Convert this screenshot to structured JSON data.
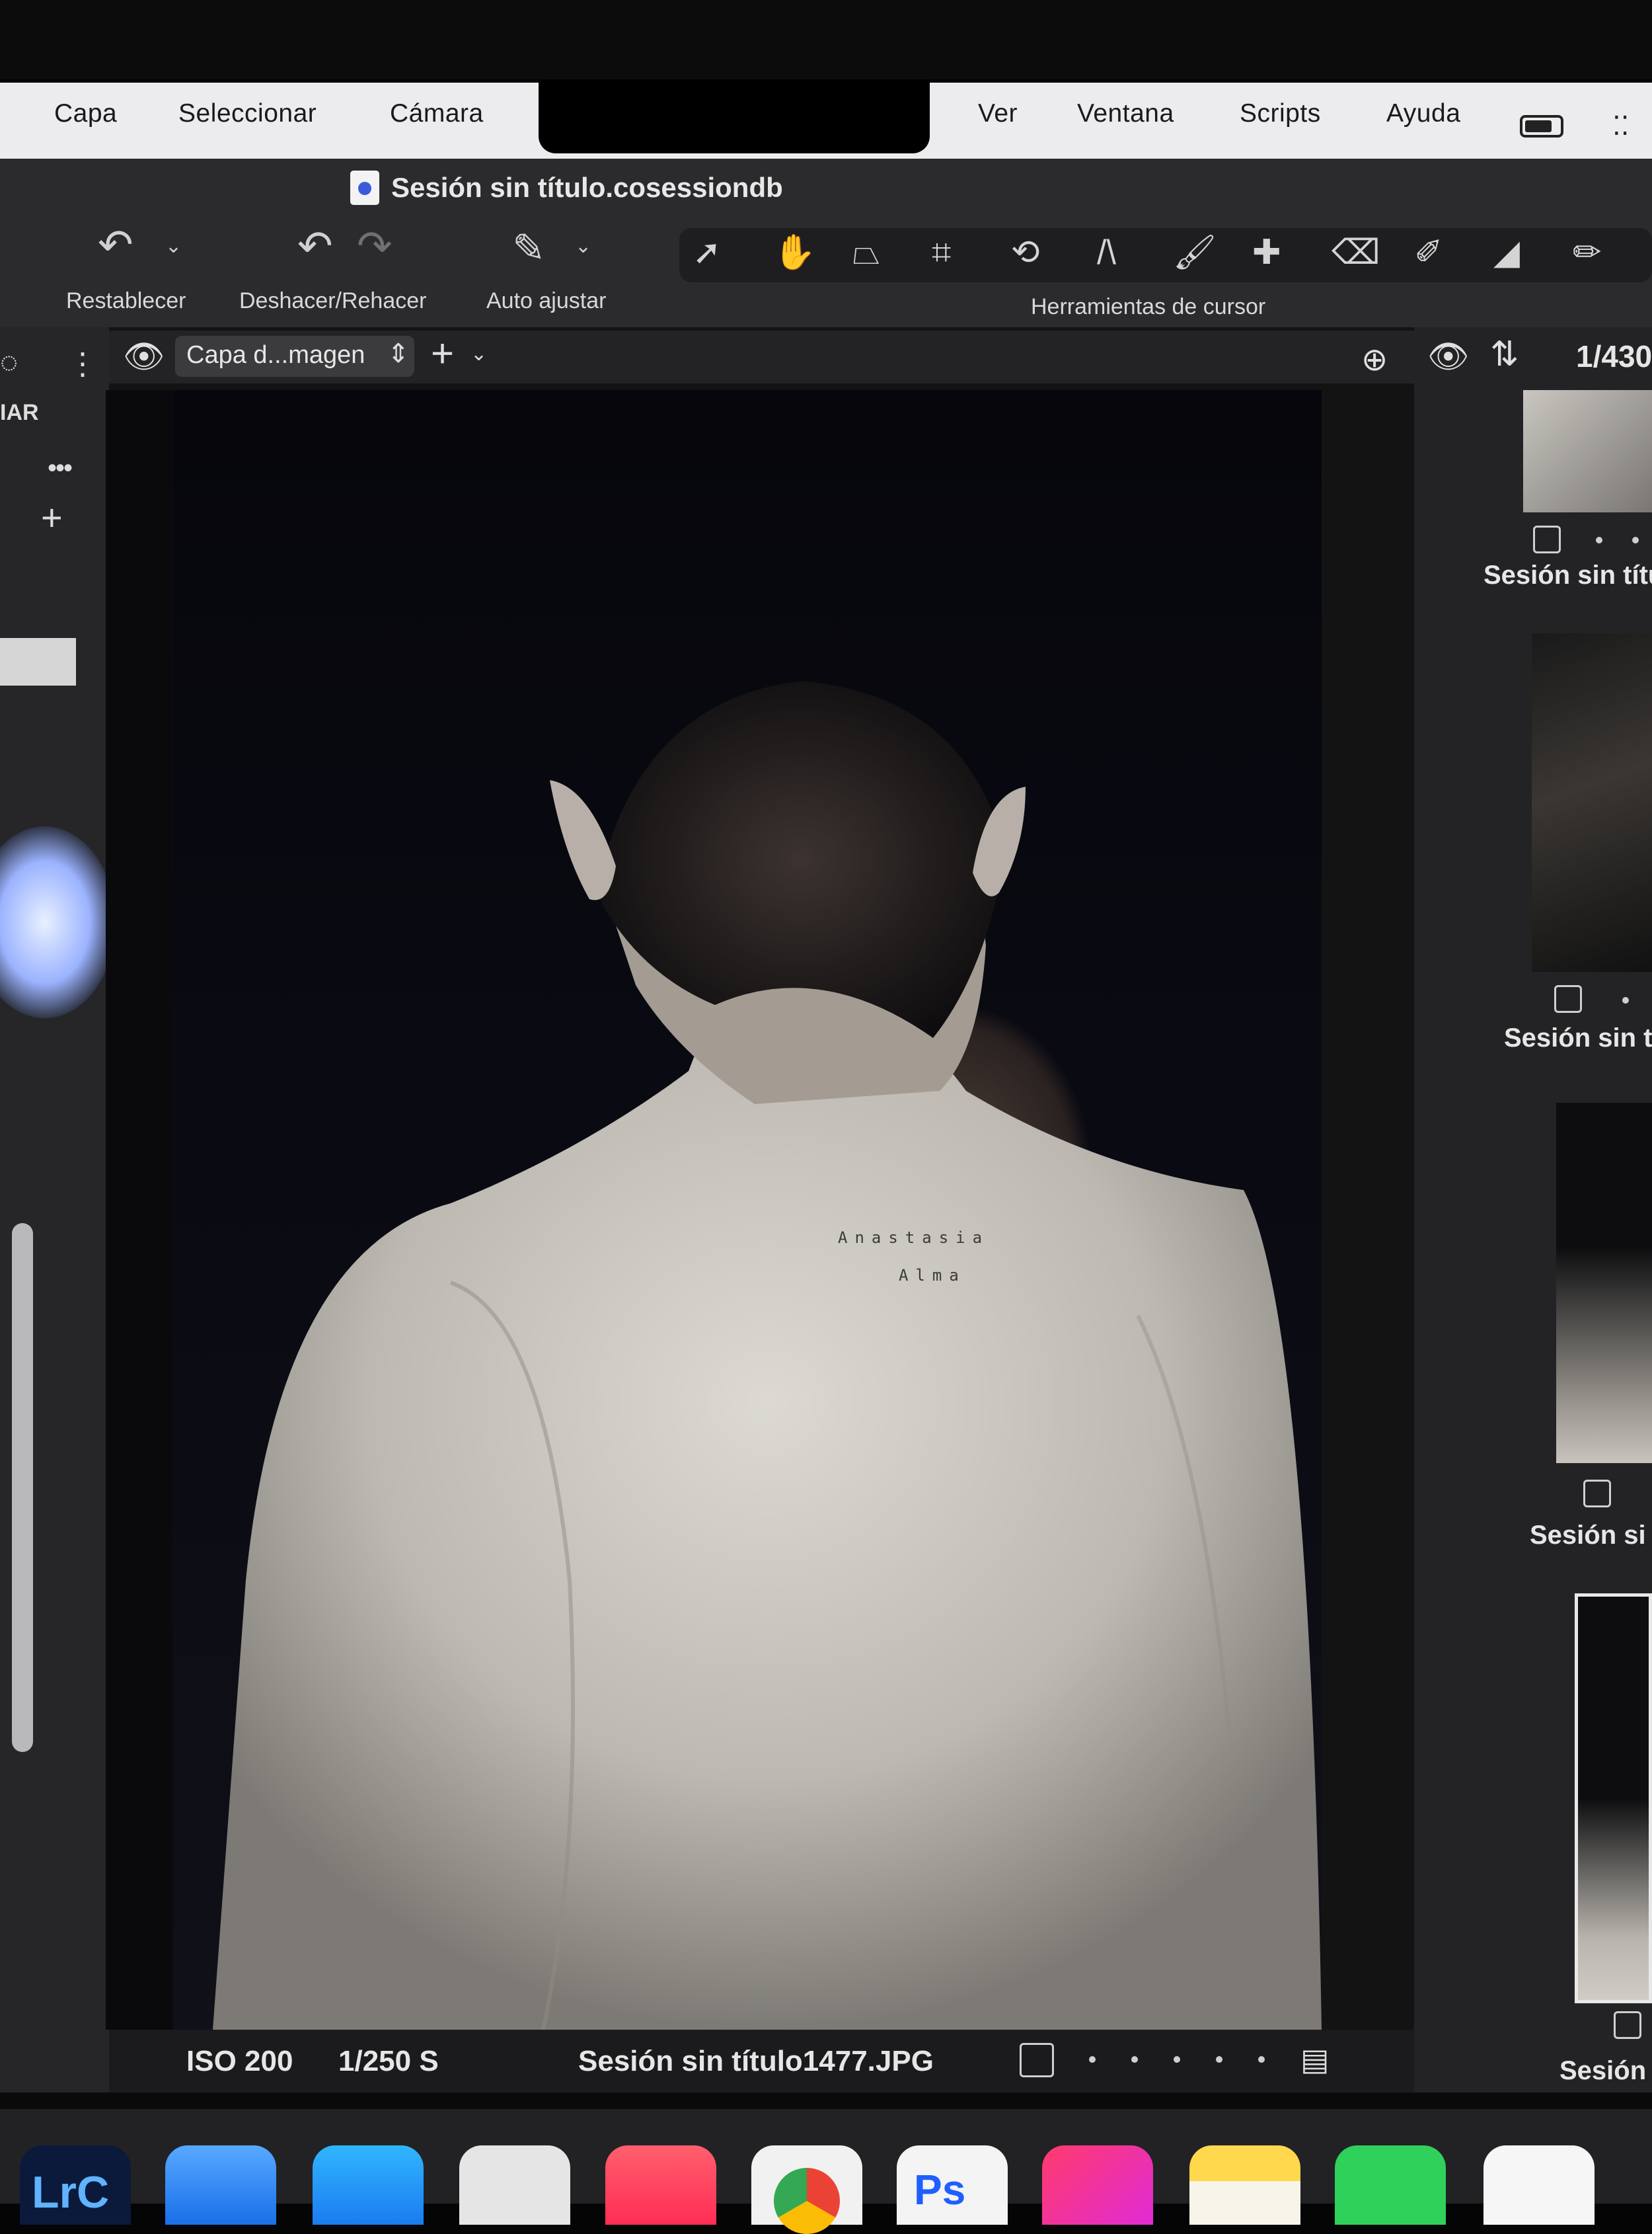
{
  "menu": {
    "items_left": [
      "Capa",
      "Seleccionar",
      "Cámara"
    ],
    "items_right": [
      "Ver",
      "Ventana",
      "Scripts",
      "Ayuda"
    ]
  },
  "document": {
    "title": "Sesión sin título.cosessiondb"
  },
  "toolbar": {
    "reset_label": "Restablecer",
    "undo_redo_label": "Deshacer/Rehacer",
    "auto_adjust_label": "Auto ajustar",
    "cursor_tools_label": "Herramientas de cursor"
  },
  "layer": {
    "selected": "Capa d...magen"
  },
  "left_panel": {
    "fragment": "IAR"
  },
  "browser": {
    "counter": "1/430",
    "thumbnails": [
      {
        "label": "Sesión sin títu"
      },
      {
        "label": "Sesión sin t"
      },
      {
        "label": "Sesión si"
      },
      {
        "label": "Sesión"
      }
    ]
  },
  "photo": {
    "tattoo_line1": "Anastasia",
    "tattoo_line2": "Alma"
  },
  "status": {
    "iso": "ISO 200",
    "shutter": "1/250 S",
    "filename": "Sesión sin título1477.JPG"
  },
  "dock": {
    "apps": [
      "lightroom-classic",
      "mail",
      "app-store",
      "system-settings",
      "music",
      "chrome",
      "photoshop",
      "creative-cloud",
      "notes",
      "whatsapp",
      "freeform"
    ],
    "lrc_label": "LrC",
    "ps_label": "Ps"
  }
}
